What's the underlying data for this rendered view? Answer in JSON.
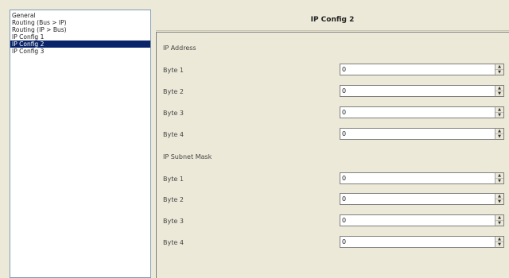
{
  "tree": {
    "items": [
      {
        "label": "General",
        "selected": false
      },
      {
        "label": "Routing (Bus > IP)",
        "selected": false
      },
      {
        "label": "Routing (IP > Bus)",
        "selected": false
      },
      {
        "label": "IP Config 1",
        "selected": false
      },
      {
        "label": "IP Config 2",
        "selected": true
      },
      {
        "label": "IP Config 3",
        "selected": false
      }
    ]
  },
  "header": {
    "title": "IP Config 2"
  },
  "ip_address": {
    "section_label": "IP Address",
    "fields": [
      {
        "label": "Byte 1",
        "value": "0"
      },
      {
        "label": "Byte 2",
        "value": "0"
      },
      {
        "label": "Byte 3",
        "value": "0"
      },
      {
        "label": "Byte 4",
        "value": "0"
      }
    ]
  },
  "subnet_mask": {
    "section_label": "IP Subnet Mask",
    "fields": [
      {
        "label": "Byte 1",
        "value": "0"
      },
      {
        "label": "Byte 2",
        "value": "0"
      },
      {
        "label": "Byte 3",
        "value": "0"
      },
      {
        "label": "Byte 4",
        "value": "0"
      }
    ]
  },
  "icons": {
    "spin_up": "arrow-up-icon",
    "spin_down": "arrow-down-icon"
  },
  "colors": {
    "selection": "#0a246a",
    "background": "#ece9d8"
  }
}
